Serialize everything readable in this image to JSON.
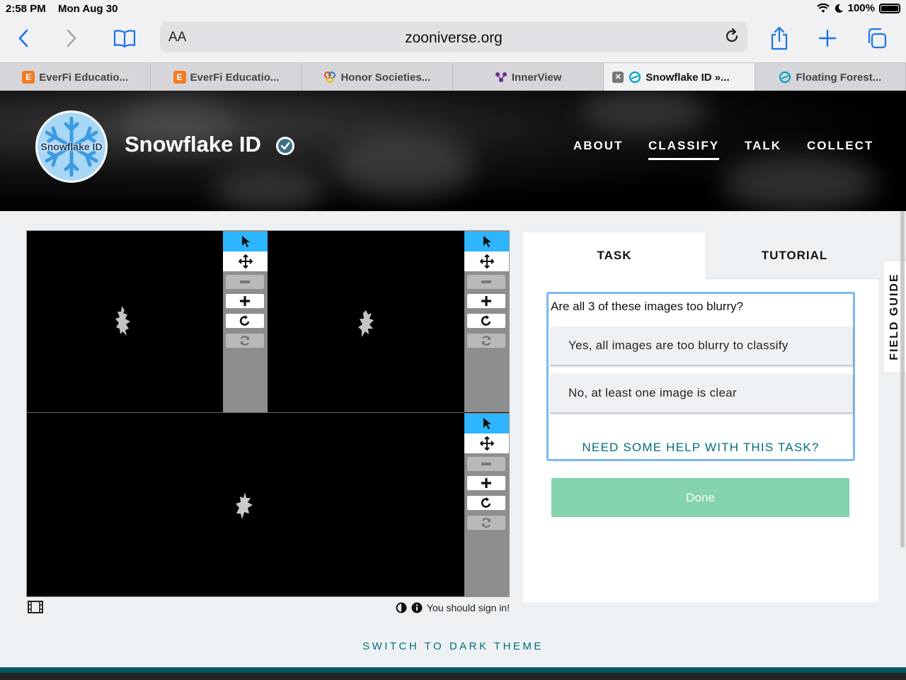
{
  "status": {
    "time": "2:58 PM",
    "date": "Mon Aug 30",
    "battery": "100%"
  },
  "browser": {
    "text_size_label": "AA",
    "url": "zooniverse.org",
    "tabs": [
      {
        "label": "EverFi Educatio...",
        "icon": "everfi-icon",
        "fav_text": "E",
        "color": "#f47b20"
      },
      {
        "label": "EverFi Educatio...",
        "icon": "everfi-icon",
        "fav_text": "E",
        "color": "#f47b20"
      },
      {
        "label": "Honor Societies...",
        "icon": "honor-societies-icon",
        "fav_text": "",
        "color": "#e0452f"
      },
      {
        "label": "InnerView",
        "icon": "innerview-icon",
        "fav_text": "",
        "color": "#6a2c91"
      },
      {
        "label": "Snowflake ID »...",
        "icon": "zooniverse-icon",
        "fav_text": "",
        "color": "#00a2c7"
      },
      {
        "label": "Floating Forest...",
        "icon": "zooniverse-icon",
        "fav_text": "",
        "color": "#00a2c7"
      }
    ],
    "active_tab": 4,
    "accent": "#1a73e8"
  },
  "project": {
    "logo_text": "Snowflake ID",
    "title": "Snowflake ID",
    "nav": [
      "ABOUT",
      "CLASSIFY",
      "TALK",
      "COLLECT"
    ],
    "active_nav": "CLASSIFY"
  },
  "viewer": {
    "signin_message": "You should sign in!"
  },
  "task": {
    "tabs": [
      "TASK",
      "TUTORIAL"
    ],
    "question": "Are all 3 of these images too blurry?",
    "answers": [
      "Yes, all images are too blurry to classify",
      "No, at least one image is clear"
    ],
    "help_label": "NEED SOME HELP WITH THIS TASK?",
    "done_label": "Done",
    "done_color": "#82d3ae"
  },
  "field_guide_label": "FIELD GUIDE",
  "theme_toggle_label": "SWITCH TO DARK THEME"
}
